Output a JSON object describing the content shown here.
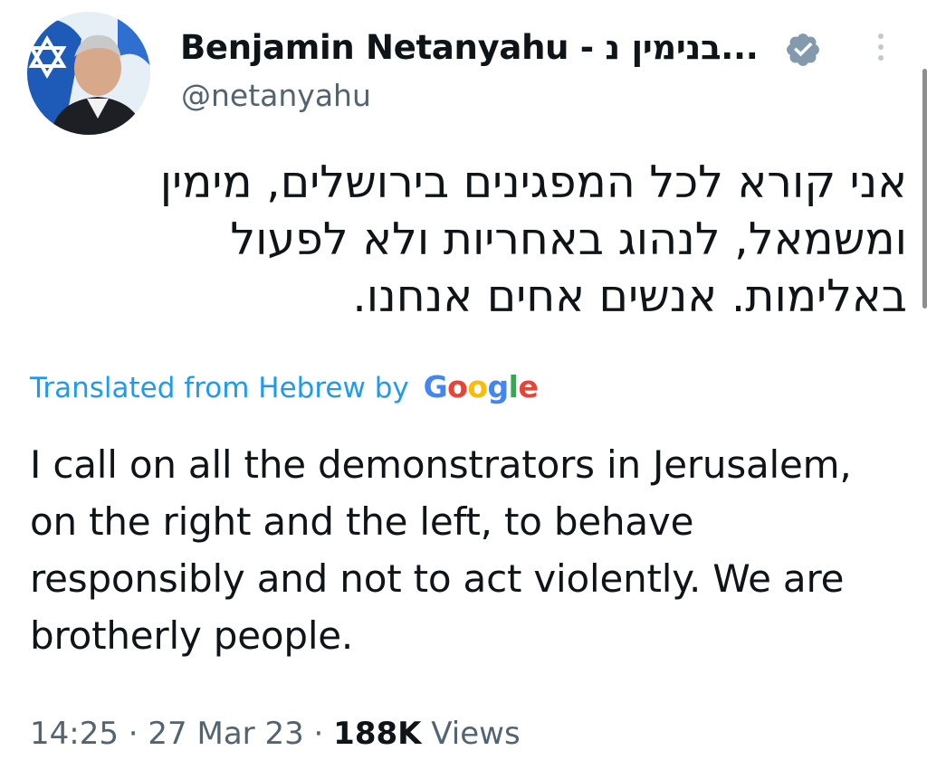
{
  "author": {
    "display_name": "Benjamin Netanyahu - בנימין נ...",
    "handle": "@netanyahu",
    "avatar_icon": "profile-photo",
    "verified_icon": "verified-badge-icon",
    "more_icon": "more-options-icon"
  },
  "tweet": {
    "original_text": "אני קורא לכל המפגינים בירושלים, מימין ומשמאל, לנהוג באחריות ולא לפעול באלימות. אנשים אחים אנחנו.",
    "translated_label": "Translated from Hebrew by",
    "translation_provider": "Google",
    "translation_text": "I call on all the demonstrators in Jerusalem, on the right and the left, to behave responsibly and not to act violently. We are brotherly people."
  },
  "meta": {
    "time": "14:25",
    "date": "27 Mar 23",
    "separator": "·",
    "views_count": "188K",
    "views_label": "Views"
  },
  "colors": {
    "link": "#1d9bf0",
    "secondary_text": "#536471",
    "primary_text": "#0f1419",
    "verified": "#829aab"
  }
}
